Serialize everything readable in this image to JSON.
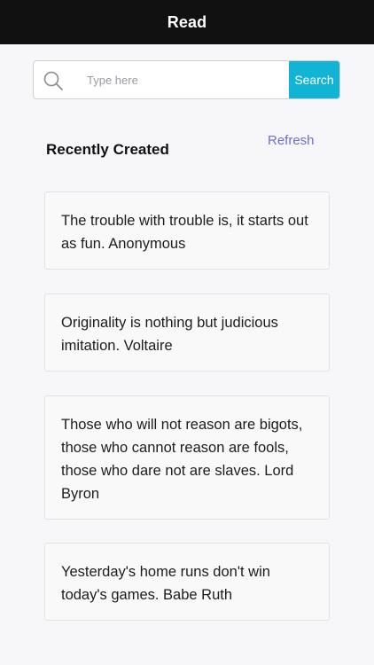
{
  "header": {
    "title": "Read"
  },
  "search": {
    "placeholder": "Type here",
    "value": "",
    "button_label": "Search",
    "accent_color": "#12b4d6"
  },
  "section": {
    "title": "Recently Created",
    "refresh_label": "Refresh",
    "refresh_color": "#6b6fcf"
  },
  "quotes": [
    {
      "text": "The trouble with trouble is, it starts out as fun. Anonymous"
    },
    {
      "text": "Originality is nothing but judicious imitation. Voltaire"
    },
    {
      "text": "Those who will not reason are bigots, those who cannot reason are fools, those who dare not are slaves. Lord Byron"
    },
    {
      "text": "Yesterday's home runs don't win today's games. Babe Ruth"
    }
  ],
  "icons": {
    "search": "search-icon"
  }
}
